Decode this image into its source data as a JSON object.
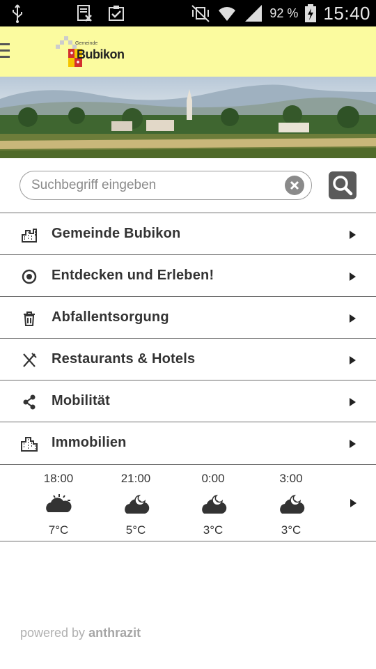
{
  "status_bar": {
    "battery": "92 %",
    "time": "15:40"
  },
  "header": {
    "logo_small": "Gemeinde",
    "logo_name": "Bubikon"
  },
  "search": {
    "placeholder": "Suchbegriff eingeben"
  },
  "menu": [
    {
      "label": "Gemeinde Bubikon",
      "icon": "city-buildings-icon"
    },
    {
      "label": "Entdecken und Erleben!",
      "icon": "target-circle-icon"
    },
    {
      "label": "Abfallentsorgung",
      "icon": "trash-can-icon"
    },
    {
      "label": "Restaurants & Hotels",
      "icon": "fork-knife-icon"
    },
    {
      "label": "Mobilität",
      "icon": "share-nodes-icon"
    },
    {
      "label": "Immobilien",
      "icon": "buildings-icon"
    }
  ],
  "weather": [
    {
      "time": "18:00",
      "temp": "7°C",
      "icon": "partly-sunny-night-icon"
    },
    {
      "time": "21:00",
      "temp": "5°C",
      "icon": "cloudy-night-icon"
    },
    {
      "time": "0:00",
      "temp": "3°C",
      "icon": "cloudy-night-icon"
    },
    {
      "time": "3:00",
      "temp": "3°C",
      "icon": "cloudy-night-icon"
    }
  ],
  "footer": {
    "prefix": "powered by",
    "brand": "anthrazit"
  },
  "colors": {
    "header_bg": "#fbfb9f",
    "text_dark": "#333333",
    "divider": "#6e6e6e"
  }
}
